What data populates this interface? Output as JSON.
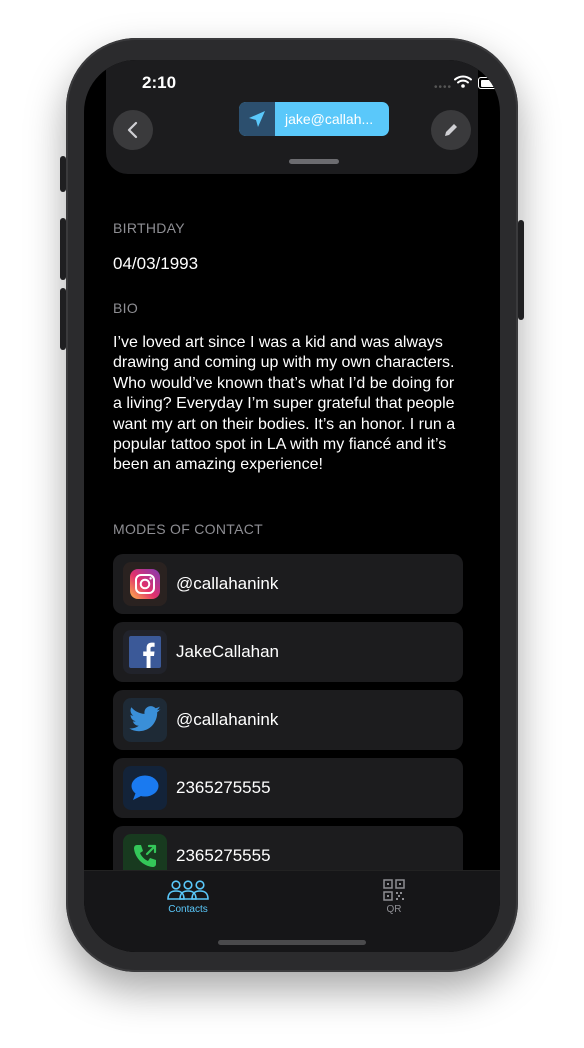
{
  "status": {
    "time": "2:10",
    "dots": "••••"
  },
  "header": {
    "email": "jake@callah..."
  },
  "birthday": {
    "label": "BIRTHDAY",
    "value": "04/03/1993"
  },
  "bio": {
    "label": "BIO",
    "text": "I’ve loved art since I was a kid and was always drawing and coming up with my own characters. Who would’ve known that’s what I’d be doing for a living? Everyday I’m super grateful that people want my art on their bodies. It’s an honor. I run a popular tattoo spot in LA with my fiancé and it’s been an amazing experience!"
  },
  "contacts": {
    "label": "MODES OF CONTACT",
    "items": [
      {
        "icon": "instagram-icon",
        "value": "@callahanink"
      },
      {
        "icon": "facebook-icon",
        "value": "JakeCallahan"
      },
      {
        "icon": "twitter-icon",
        "value": "@callahanink"
      },
      {
        "icon": "message-icon",
        "value": "2365275555"
      },
      {
        "icon": "phone-icon",
        "value": "2365275555"
      }
    ]
  },
  "tabs": [
    {
      "label": "Contacts",
      "icon": "people-icon",
      "color": "#5ac8fa"
    },
    {
      "label": "QR",
      "icon": "qr-code-icon",
      "color": "#8e8e93"
    }
  ]
}
